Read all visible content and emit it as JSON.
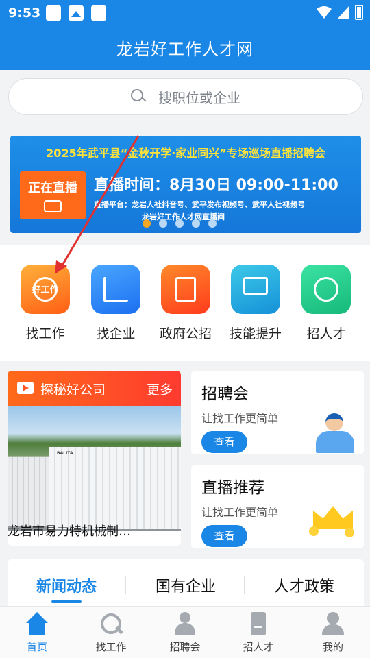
{
  "status": {
    "time": "9:53"
  },
  "header": {
    "title": "龙岩好工作人才网"
  },
  "search": {
    "placeholder": "搜职位或企业"
  },
  "banner": {
    "title": "2025年武平县“金秋开学·家业同兴”专场巡场直播招聘会",
    "live_label": "正在直播",
    "time_text": "直播时间：8月30日 09:00-11:00",
    "platform_text": "直播平台：龙岩人社抖音号、武平发布视频号、武平人社视频号",
    "room_text": "龙岩好工作人才网直播间",
    "dots": 5,
    "active_dot": 0
  },
  "menu": {
    "items": [
      {
        "label": "找工作",
        "icon": "find-job-icon",
        "icon_text": "好工作"
      },
      {
        "label": "找企业",
        "icon": "find-company-icon"
      },
      {
        "label": "政府公招",
        "icon": "gov-recruit-icon"
      },
      {
        "label": "技能提升",
        "icon": "skill-icon"
      },
      {
        "label": "招人才",
        "icon": "recruit-talent-icon"
      }
    ]
  },
  "featured": {
    "title": "探秘好公司",
    "more": "更多",
    "company": "龙岩市易力特机械制…",
    "sign_text": "BALITA"
  },
  "cards": [
    {
      "title": "招聘会",
      "subtitle": "让找工作更简单",
      "button": "查看"
    },
    {
      "title": "直播推荐",
      "subtitle": "让找工作更简单",
      "button": "查看"
    }
  ],
  "news": {
    "tabs": [
      {
        "label": "新闻动态"
      },
      {
        "label": "国有企业"
      },
      {
        "label": "人才政策"
      }
    ],
    "active_tab": 0
  },
  "bottom_nav": {
    "items": [
      {
        "label": "首页",
        "icon": "home-icon"
      },
      {
        "label": "找工作",
        "icon": "search-icon"
      },
      {
        "label": "招聘会",
        "icon": "job-fair-icon"
      },
      {
        "label": "招人才",
        "icon": "document-icon"
      },
      {
        "label": "我的",
        "icon": "user-icon"
      }
    ],
    "active": 0
  },
  "colors": {
    "primary": "#1a86e6",
    "accent_orange": "#ff6a1a",
    "banner_title": "#ffe23a"
  }
}
